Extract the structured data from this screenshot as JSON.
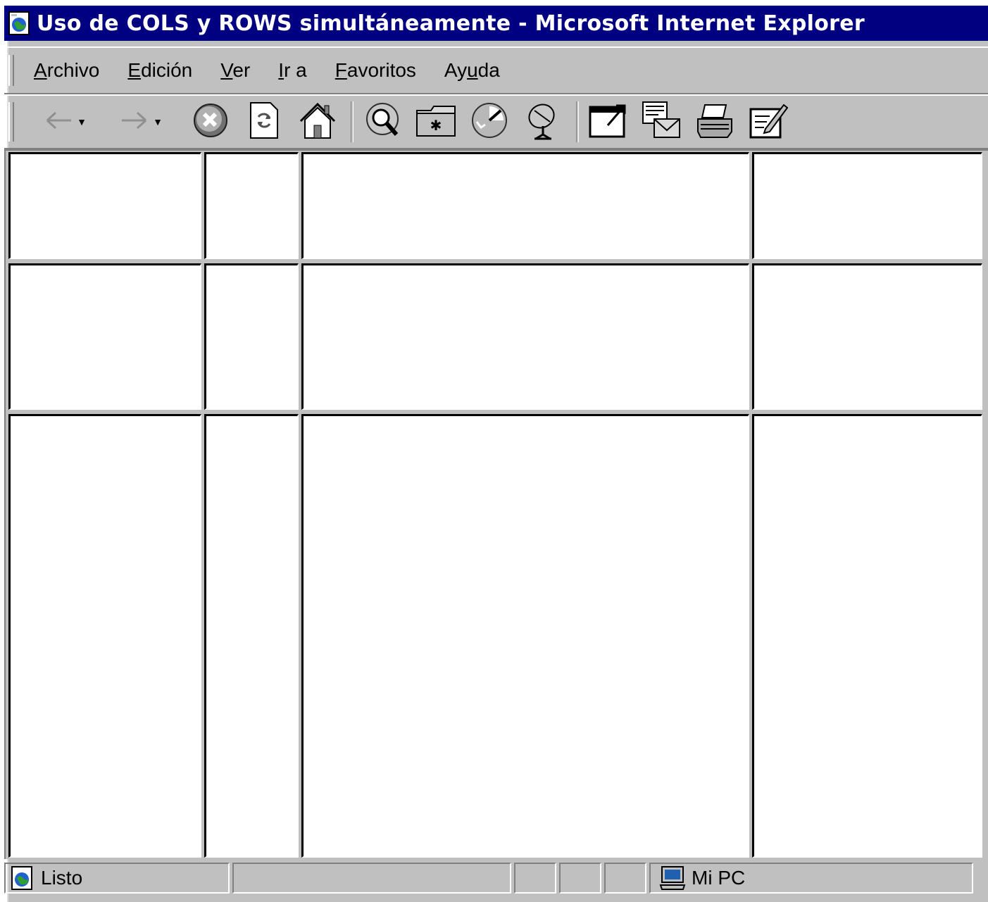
{
  "window": {
    "title": "Uso de COLS y ROWS simultáneamente - Microsoft Internet Explorer"
  },
  "menubar": {
    "items": [
      {
        "mnemonic": "A",
        "rest": "rchivo"
      },
      {
        "mnemonic": "E",
        "rest": "dición"
      },
      {
        "mnemonic": "V",
        "rest": "er"
      },
      {
        "mnemonic": "I",
        "rest": "r a"
      },
      {
        "mnemonic": "F",
        "rest": "avoritos"
      },
      {
        "pre": "Ay",
        "mnemonic": "u",
        "rest": "da"
      }
    ]
  },
  "toolbar": {
    "buttons": [
      "back-icon",
      "forward-icon",
      "stop-icon",
      "refresh-icon",
      "home-icon",
      "search-icon",
      "favorites-icon",
      "history-icon",
      "channels-icon",
      "fullscreen-icon",
      "mail-icon",
      "print-icon",
      "edit-icon"
    ]
  },
  "statusbar": {
    "status": "Listo",
    "zone": "Mi PC"
  }
}
